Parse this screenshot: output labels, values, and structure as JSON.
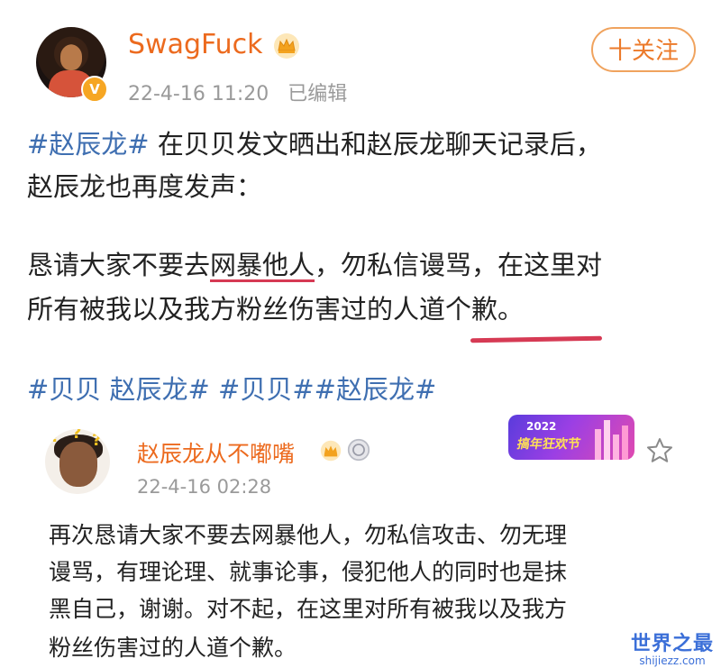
{
  "post": {
    "username": "SwagFuck",
    "date": "22-4-16 11:20",
    "edited": "已编辑",
    "follow_label": "十关注",
    "line1_tag": "#赵辰龙#",
    "line1_rest": " 在贝贝发文晒出和赵辰龙聊天记录后，",
    "line2": "赵辰龙也再度发声：",
    "line3_a": "恳请大家不要去",
    "line3_u": "网暴他人",
    "line3_b": "，勿私信谩骂，在这里对",
    "line4": "所有被我以及我方粉丝伤害过的人道个歉。",
    "tag1": "#贝贝 赵辰龙#",
    "tag2": "#贝贝#",
    "tag3": "#赵辰龙#"
  },
  "repost": {
    "username": "赵辰龙从不嘟嘴",
    "date": "22-4-16 02:28",
    "banner_year": "2022",
    "banner_text": "搞年狂欢节",
    "line1": "再次恳请大家不要去网暴他人，勿私信攻击、勿无理",
    "line2": "谩骂，有理论理、就事论事，侵犯他人的同时也是抹",
    "line3": "黑自己，谢谢。对不起，在这里对所有被我以及我方",
    "line4": "粉丝伤害过的人道个歉。"
  },
  "watermark": {
    "title": "世界之最",
    "url": "shijiezz.com"
  },
  "colors": {
    "username": "#ec6a1e",
    "hashtag": "#3f6fb1",
    "underline": "#d63a54",
    "meta": "#9a9a9a"
  }
}
